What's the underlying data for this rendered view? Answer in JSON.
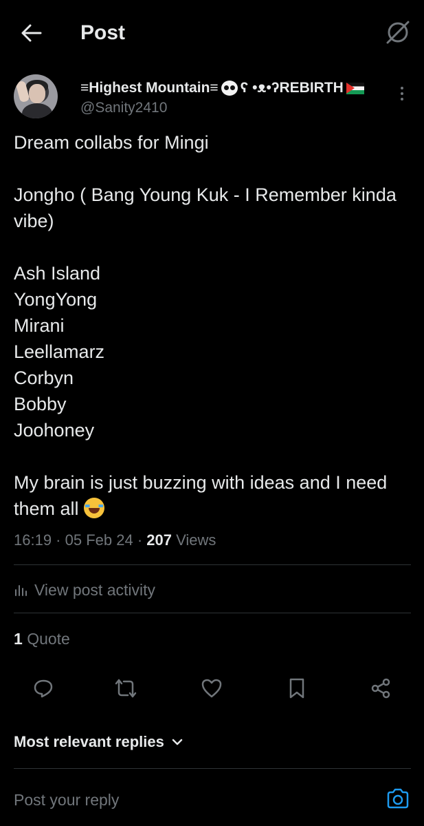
{
  "header": {
    "title": "Post"
  },
  "author": {
    "display_name": "≡Highest Mountain≡",
    "display_name_suffix": "ʕ •ᴥ•ʔREBIRTH",
    "handle": "@Sanity2410"
  },
  "post": {
    "line1": "Dream collabs for Mingi",
    "line2": "Jongho ( Bang Young Kuk - I Remember kinda vibe)",
    "names": [
      "Ash Island",
      "YongYong",
      "Mirani",
      "Leellamarz",
      "Corbyn",
      "Bobby",
      "Joohoney"
    ],
    "closing": "My brain is just buzzing with ideas and I need them all",
    "time": "16:19",
    "date": "05 Feb 24",
    "views_count": "207",
    "views_label": "Views"
  },
  "activity": {
    "label": "View post activity"
  },
  "quotes": {
    "count": "1",
    "label": "Quote"
  },
  "replies": {
    "sort_label": "Most relevant replies",
    "placeholder": "Post your reply"
  },
  "icons": {
    "back": "arrow-left-icon",
    "grok": "grok-icon",
    "more": "more-vertical-icon",
    "reply": "reply-icon",
    "repost": "repost-icon",
    "like": "heart-icon",
    "bookmark": "bookmark-icon",
    "share": "share-icon",
    "camera": "camera-icon"
  },
  "colors": {
    "background": "#000000",
    "text": "#e7e9ea",
    "secondary": "#71767b",
    "accent": "#1d9bf0",
    "divider": "#2f3336"
  }
}
